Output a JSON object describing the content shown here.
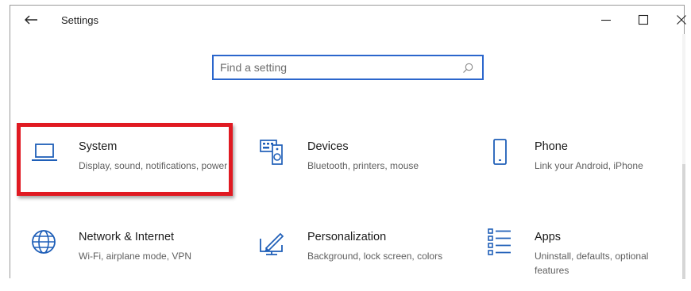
{
  "window": {
    "title": "Settings",
    "controls": [
      "minimize",
      "maximize",
      "close"
    ]
  },
  "search": {
    "placeholder": "Find a setting",
    "value": ""
  },
  "categories": [
    {
      "name": "System",
      "description": "Display, sound, notifications, power",
      "icon": "laptop-icon"
    },
    {
      "name": "Devices",
      "description": "Bluetooth, printers, mouse",
      "icon": "keyboard-speaker-icon"
    },
    {
      "name": "Phone",
      "description": "Link your Android, iPhone",
      "icon": "phone-icon"
    },
    {
      "name": "Network & Internet",
      "description": "Wi-Fi, airplane mode, VPN",
      "icon": "globe-icon"
    },
    {
      "name": "Personalization",
      "description": "Background, lock screen, colors",
      "icon": "paintbrush-display-icon"
    },
    {
      "name": "Apps",
      "description": "Uninstall, defaults, optional features",
      "icon": "apps-list-icon"
    }
  ],
  "highlight": {
    "target": "System",
    "color": "#e01a22"
  },
  "colors": {
    "accent": "#2b66cc",
    "icon": "#1f5fb8"
  }
}
